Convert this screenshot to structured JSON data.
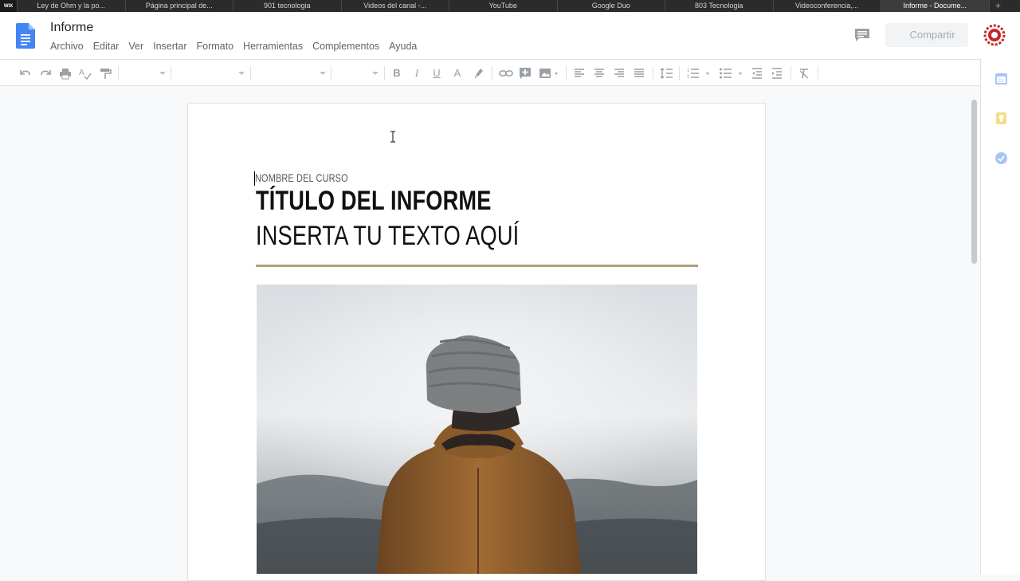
{
  "browser": {
    "favicon_label": "WIX",
    "tabs": [
      {
        "label": "Ley de Ohm y la po..."
      },
      {
        "label": "Página principal de..."
      },
      {
        "label": "901 tecnologia"
      },
      {
        "label": "Videos del canal -..."
      },
      {
        "label": "YouTube"
      },
      {
        "label": "Google Duo"
      },
      {
        "label": "803 Tecnologia"
      },
      {
        "label": "Videoconferencia,..."
      },
      {
        "label": "Informe - Docume..."
      }
    ],
    "new_tab_symbol": "+"
  },
  "header": {
    "title": "Informe",
    "menu": [
      "Archivo",
      "Editar",
      "Ver",
      "Insertar",
      "Formato",
      "Herramientas",
      "Complementos",
      "Ayuda"
    ],
    "share_label": "Compartir"
  },
  "toolbar": {
    "bold": "B",
    "italic": "I",
    "underline": "U",
    "text_color": "A"
  },
  "document": {
    "course_name": "NOMBRE DEL CURSO",
    "report_title": "TÍTULO DEL INFORME",
    "placeholder_text": "INSERTA TU TEXTO AQUÍ"
  },
  "colors": {
    "accent_rule": "#b19f7d",
    "docs_blue": "#4285f4",
    "jacket": "#9a6630"
  }
}
